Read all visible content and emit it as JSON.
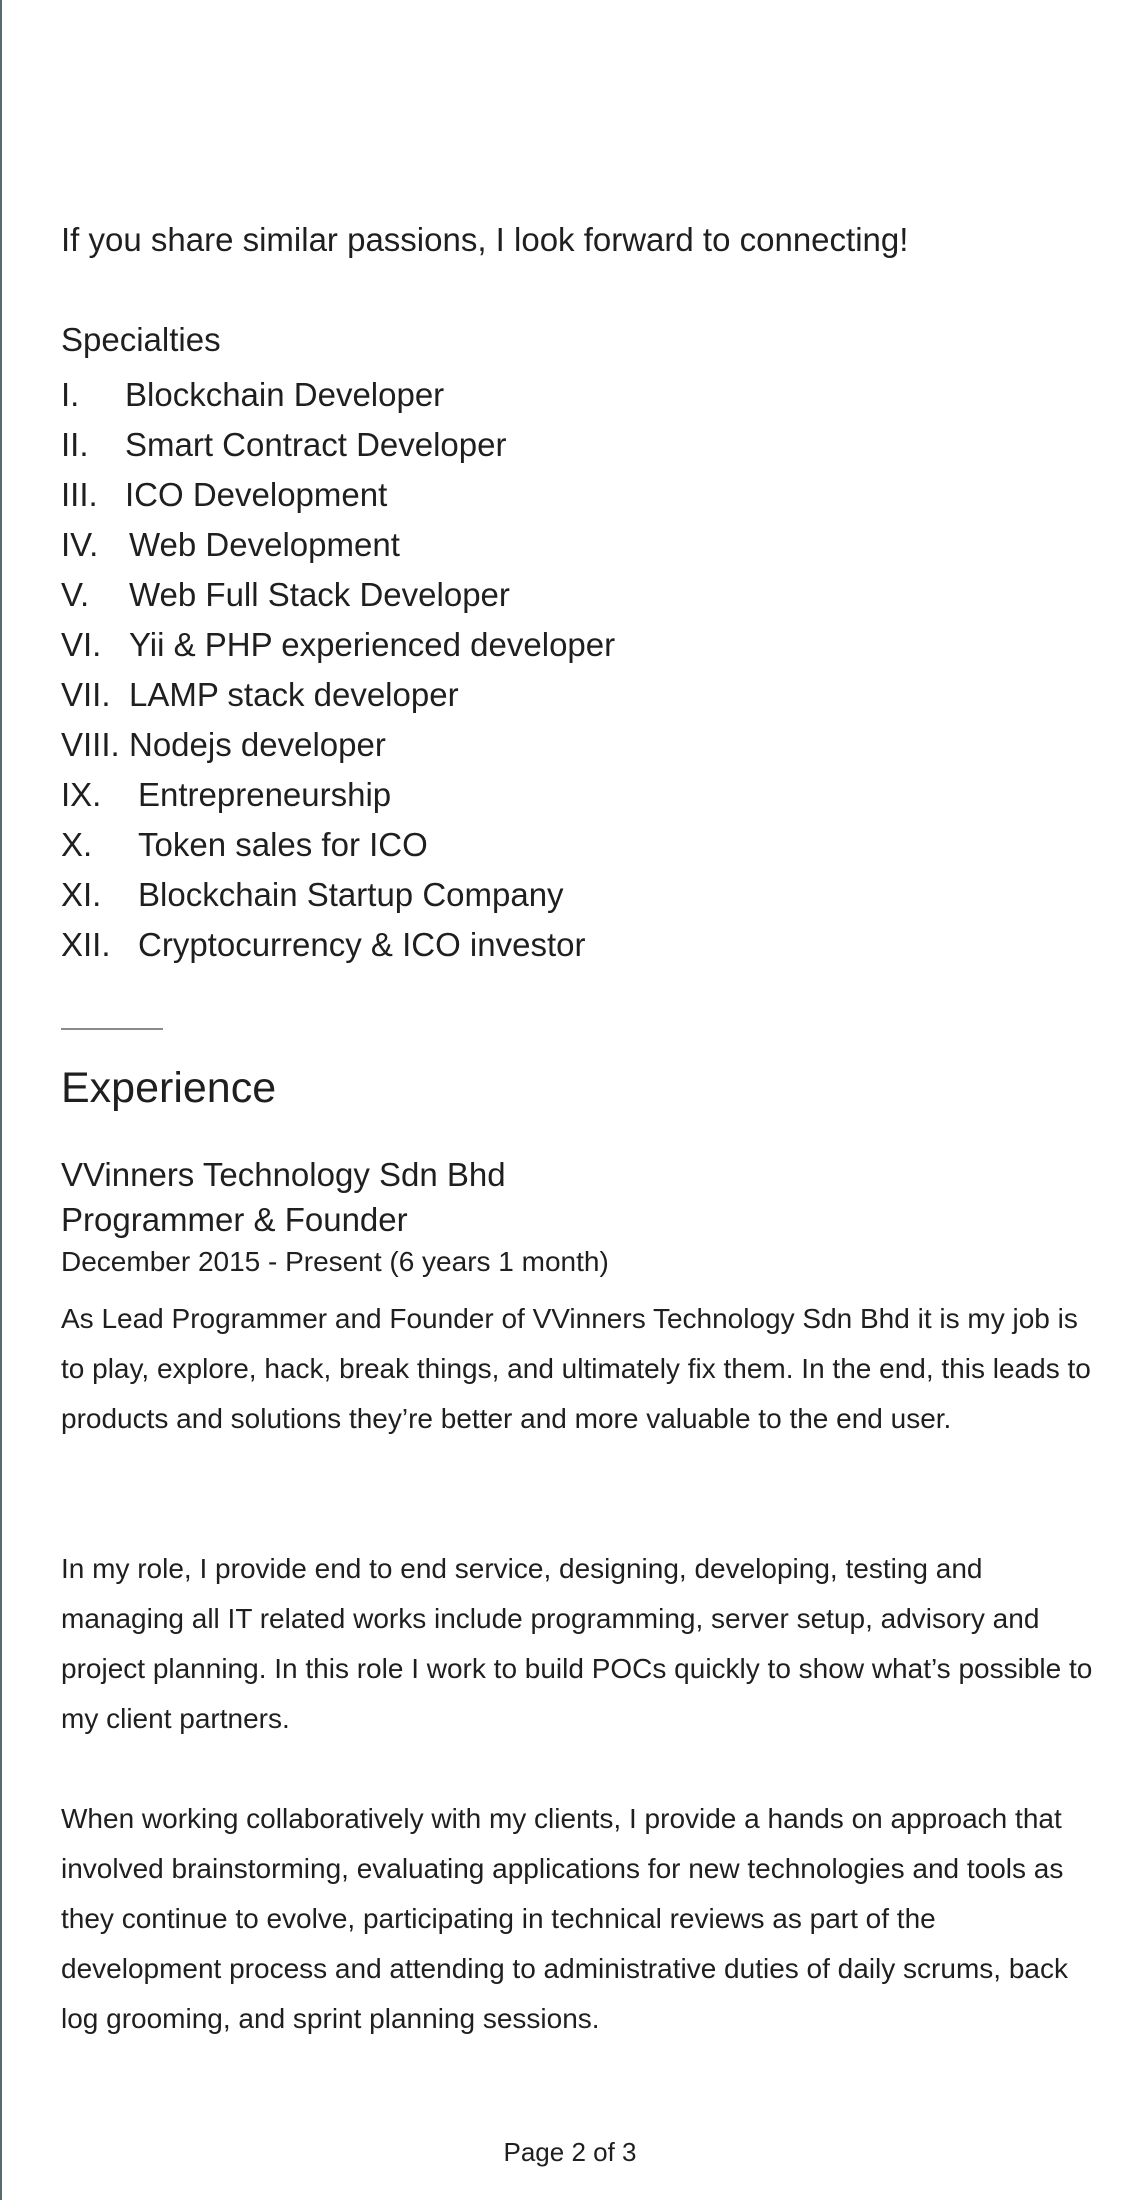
{
  "intro": {
    "text": "If you share similar passions, I look forward to connecting!"
  },
  "specialties": {
    "heading": "Specialties",
    "items": [
      {
        "num": "I.",
        "label": "Blockchain Developer"
      },
      {
        "num": "II.",
        "label": "Smart Contract Developer"
      },
      {
        "num": "III.",
        "label": "ICO Development"
      },
      {
        "num": "IV.",
        "label": "Web Development"
      },
      {
        "num": "V.",
        "label": "Web Full Stack Developer"
      },
      {
        "num": "VI.",
        "label": "Yii & PHP experienced developer"
      },
      {
        "num": "VII.",
        "label": "LAMP stack developer"
      },
      {
        "num": "VIII.",
        "label": "Nodejs developer"
      },
      {
        "num": "IX.",
        "label": "Entrepreneurship"
      },
      {
        "num": "X.",
        "label": "Token sales for ICO"
      },
      {
        "num": "XI.",
        "label": "Blockchain Startup Company"
      },
      {
        "num": "XII.",
        "label": "Cryptocurrency & ICO investor"
      }
    ]
  },
  "experience": {
    "title": "Experience",
    "company": "VVinners Technology Sdn Bhd",
    "role": "Programmer & Founder",
    "dates": "December 2015 - Present (6 years 1 month)",
    "paragraphs": [
      "As Lead Programmer and Founder of VVinners Technology Sdn Bhd it is my job is to play, explore, hack, break things, and ultimately fix them. In the end, this leads to products and solutions they’re better and more valuable to the end user.",
      "In my role, I provide end to end service, designing, developing, testing and managing all IT related works include programming, server setup, advisory and project planning. In this role I work to build POCs quickly to show what’s possible to my client partners.",
      "When working collaboratively with my clients, I provide a hands on approach that involved brainstorming, evaluating applications for new technologies and tools as they continue to evolve, participating in technical reviews as part of the development process and attending to administrative duties of daily scrums, back log grooming, and sprint planning sessions."
    ]
  },
  "footer": {
    "page_label": "Page 2 of 3"
  },
  "colors": {
    "text": "#1f1f1f",
    "divider": "#8a8a8a",
    "left_border": "#5a6a70",
    "background": "#ffffff"
  }
}
